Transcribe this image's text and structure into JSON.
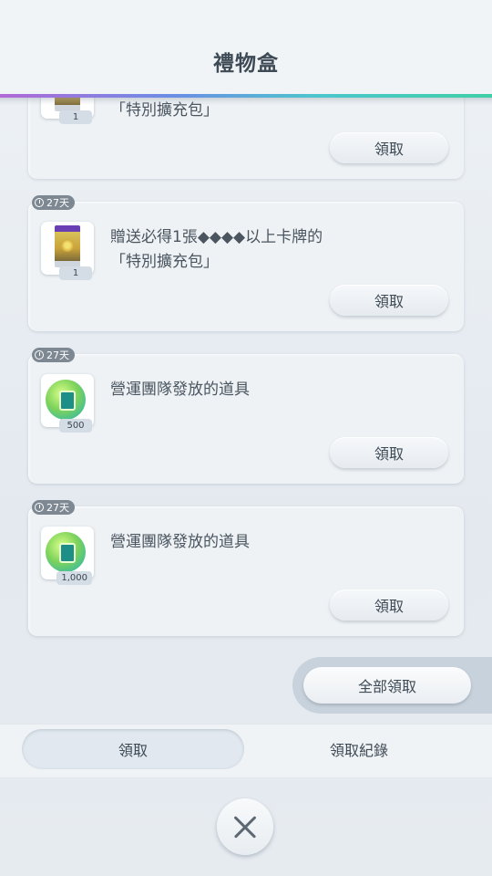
{
  "header": {
    "title": "禮物盒"
  },
  "gifts": [
    {
      "badge": "",
      "lines": [
        "「特別擴充包」"
      ],
      "qty": "1",
      "claim_label": "領取"
    },
    {
      "badge": "27天",
      "lines": [
        "贈送必得1張◆◆◆◆以上卡牌的",
        "「特別擴充包」"
      ],
      "qty": "1",
      "claim_label": "領取"
    },
    {
      "badge": "27天",
      "lines": [
        "營運團隊發放的道具"
      ],
      "qty": "500",
      "claim_label": "領取"
    },
    {
      "badge": "27天",
      "lines": [
        "營運團隊發放的道具"
      ],
      "qty": "1,000",
      "claim_label": "領取"
    }
  ],
  "claim_all_label": "全部領取",
  "tabs": [
    {
      "label": "領取",
      "active": true
    },
    {
      "label": "領取紀錄",
      "active": false
    }
  ],
  "icons": {
    "close": "close-icon",
    "clock": "clock-icon",
    "pack": "booster-pack-icon",
    "shop_ticket": "shop-ticket-icon"
  }
}
